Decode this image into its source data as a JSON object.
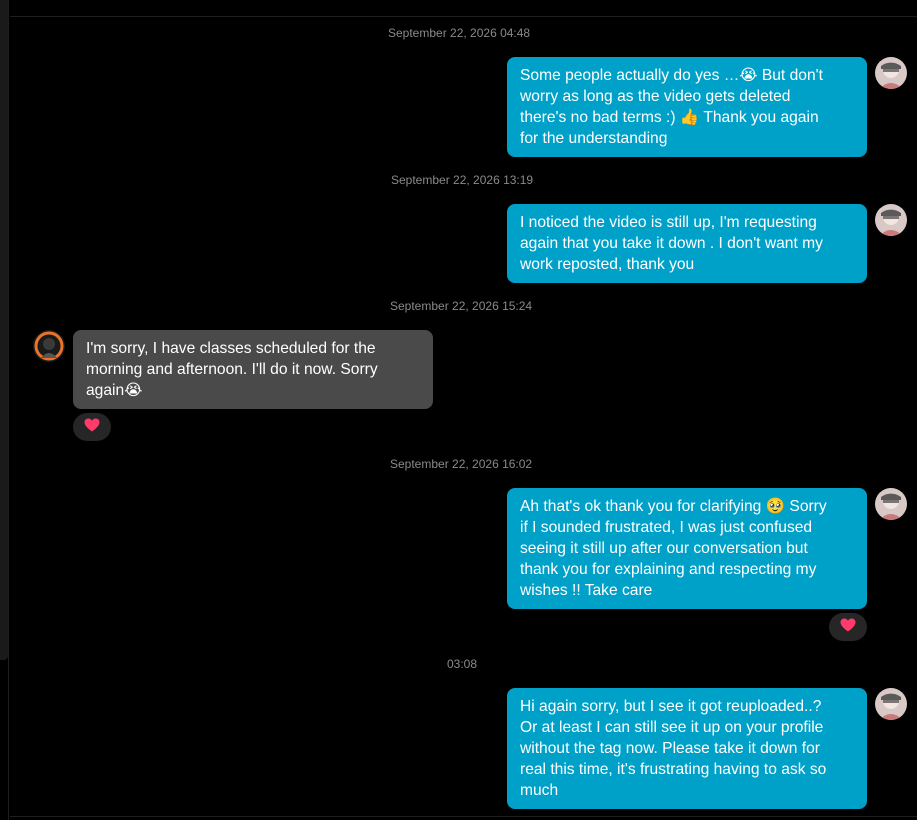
{
  "colors": {
    "outgoing_bubble": "#00a1c9",
    "incoming_bubble": "#4a4a4a",
    "background": "#000000",
    "reaction_heart": "#ff3b6b"
  },
  "messages": [
    {
      "timestamp": "September 22, 2026 04:48",
      "lines": [
        "Some people actually do yes …😭 But don't",
        "worry as long as the video gets deleted",
        "there's no bad terms :) 👍 Thank you again",
        "for the understanding"
      ]
    },
    {
      "timestamp": "September 22, 2026 13:19",
      "lines": [
        "I noticed the video is still up, I'm requesting",
        "again that you take it down . I don't want my",
        "work reposted, thank you"
      ]
    },
    {
      "timestamp": "September 22, 2026 15:24",
      "lines": [
        "I'm sorry, I have classes scheduled for the",
        "morning and afternoon. I'll do it now. Sorry",
        "again😭"
      ],
      "reaction": "heart-icon"
    },
    {
      "timestamp": "September 22, 2026 16:02",
      "lines": [
        "Ah that's ok thank you for clarifying 🥹 Sorry",
        "if I sounded frustrated, I was just confused",
        "seeing it still up after our conversation but",
        "thank you for explaining and respecting my",
        "wishes !! Take care"
      ],
      "reaction": "heart-icon"
    },
    {
      "timestamp": "03:08",
      "lines": [
        "Hi again sorry, but I see it got reuploaded..?",
        "Or at least I can still see it up on your profile",
        "without the tag now. Please take it down for",
        "real this time, it's frustrating having to ask so",
        "much"
      ]
    }
  ]
}
